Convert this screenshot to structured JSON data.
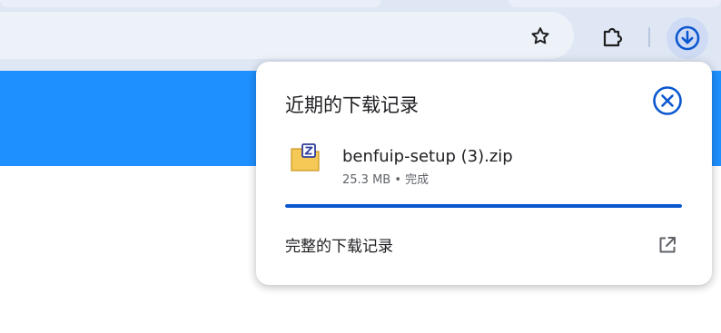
{
  "toolbar": {
    "bookmark_icon": "star-outline",
    "extensions_icon": "puzzle",
    "downloads_icon": "download-arrow-circle"
  },
  "download_bubble": {
    "title": "近期的下载记录",
    "close_icon": "close-circle",
    "items": [
      {
        "icon": "zip-archive",
        "file_name": "benfuip-setup (3).zip",
        "meta": "25.3 MB • 完成",
        "progress_percent": 100
      }
    ],
    "full_history_label": "完整的下载记录",
    "open_icon": "open-in-new"
  },
  "colors": {
    "accent": "#0b57d0",
    "page_band": "#1e90ff",
    "toolbar_bg": "#dfe7f5"
  }
}
